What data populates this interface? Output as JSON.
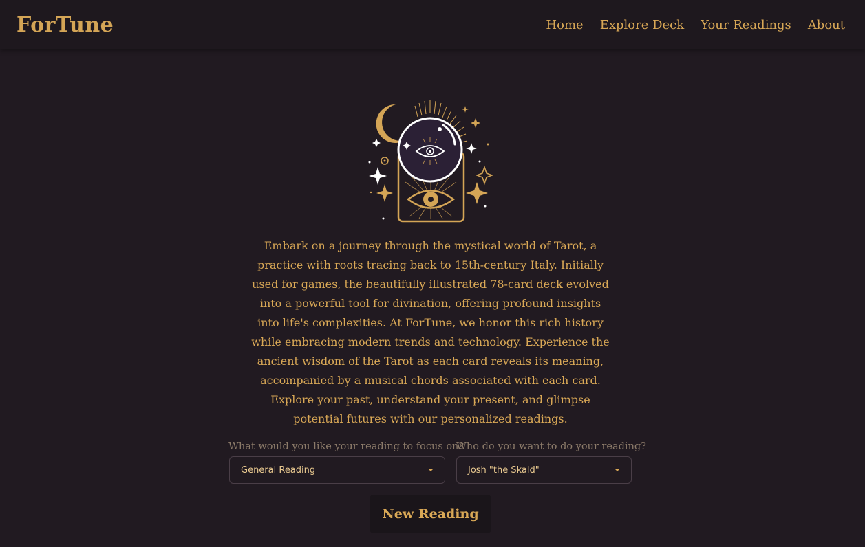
{
  "header": {
    "brand": "ForTune",
    "nav": [
      {
        "label": "Home"
      },
      {
        "label": "Explore Deck"
      },
      {
        "label": "Your Readings"
      },
      {
        "label": "About"
      }
    ]
  },
  "main": {
    "intro": "Embark on a journey through the mystical world of Tarot, a practice with roots tracing back to 15th-century Italy. Initially used for games, the beautifully illustrated 78-card deck evolved into a powerful tool for divination, offering profound insights into life's complexities. At ForTune, we honor this rich history while embracing modern trends and technology. Experience the ancient wisdom of the Tarot as each card reveals its meaning, accompanied by a musical chords associated with each card. Explore your past, understand your present, and glimpse potential futures with our personalized readings.",
    "focus": {
      "label": "What would you like your reading to focus on?",
      "value": "General Reading"
    },
    "reader": {
      "label": "Who do you want to do your reading?",
      "value": "Josh \"the Skald\""
    },
    "action_label": "New Reading"
  },
  "colors": {
    "background": "#211a21",
    "header": "#1e181e",
    "gold": "#d9a856",
    "muted": "#8b7a69"
  }
}
